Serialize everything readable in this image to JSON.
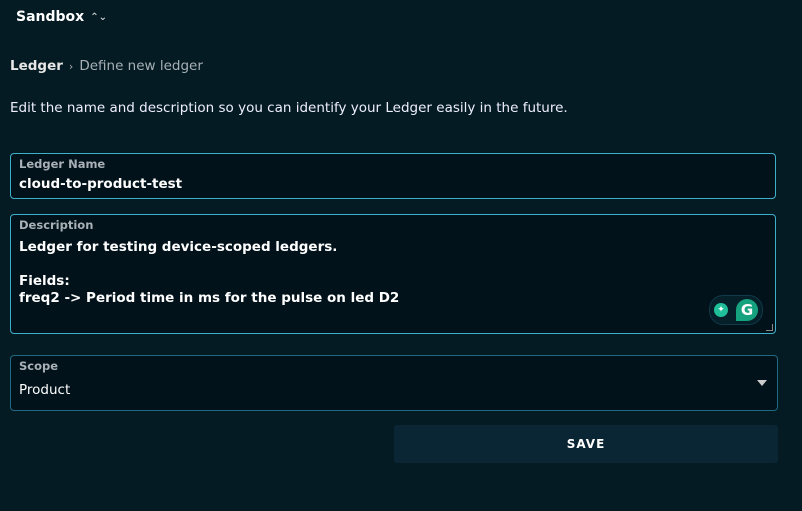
{
  "header": {
    "org": "Sandbox",
    "org_icon": "chevron-up-down-icon"
  },
  "breadcrumb": {
    "root": "Ledger",
    "separator": "›",
    "current": "Define new ledger"
  },
  "intro": "Edit the name and description so you can identify your Ledger easily in the future.",
  "form": {
    "name": {
      "label": "Ledger Name",
      "value": "cloud-to-product-test"
    },
    "description": {
      "label": "Description",
      "value": "Ledger for testing device-scoped ledgers.\n\nFields:\nfreq2 -> Period time in ms for the pulse on led D2"
    },
    "scope": {
      "label": "Scope",
      "value": "Product"
    },
    "save_label": "SAVE"
  },
  "grammarly": {
    "logo": "G"
  },
  "colors": {
    "background": "#041b24",
    "field_border": "#3eb0cc",
    "save_bg": "#0a2533",
    "grammarly": "#15a37f"
  }
}
